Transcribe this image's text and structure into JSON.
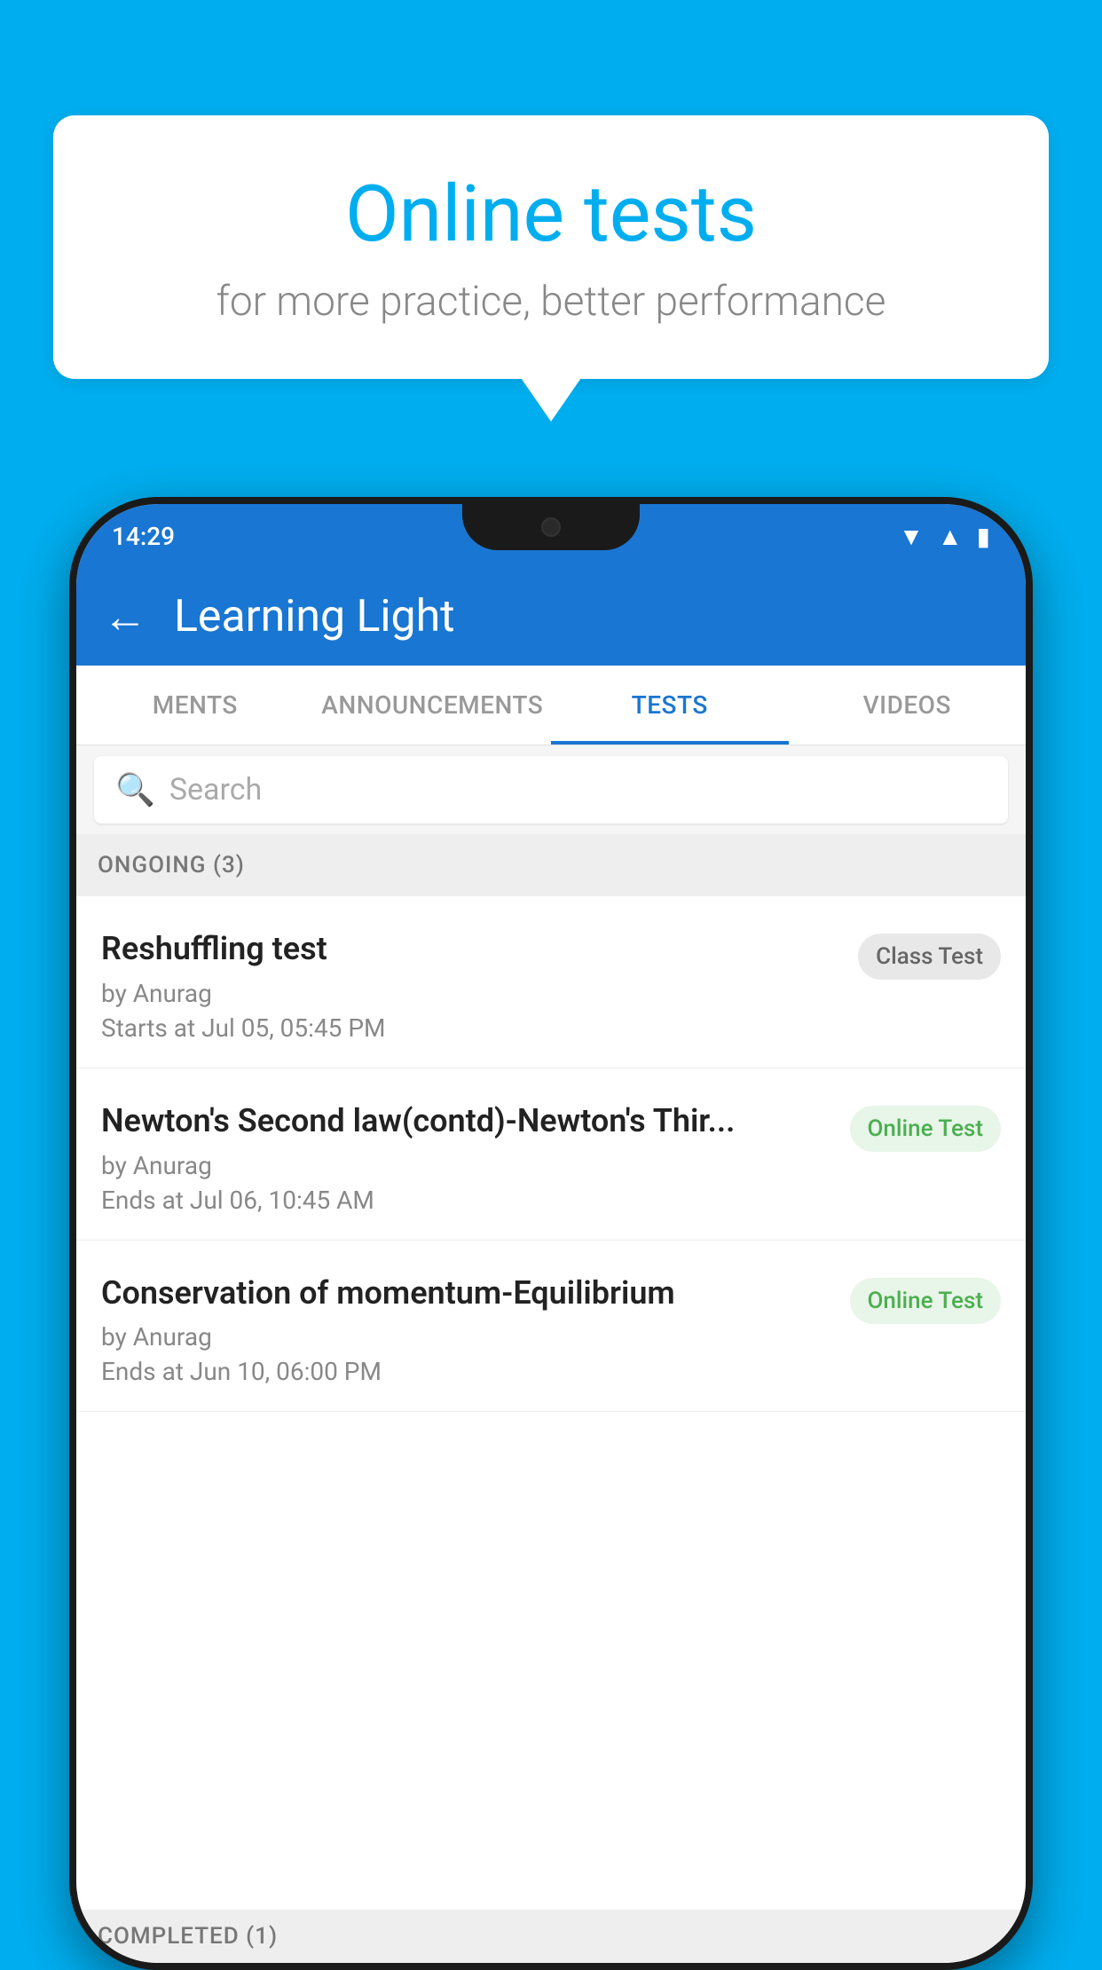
{
  "background_color": "#00AEEF",
  "speech_bubble": {
    "title": "Online tests",
    "subtitle": "for more practice, better performance"
  },
  "phone": {
    "status_bar": {
      "time": "14:29",
      "icons": [
        "wifi",
        "signal",
        "battery"
      ]
    },
    "header": {
      "back_label": "←",
      "title": "Learning Light"
    },
    "tabs": [
      {
        "label": "MENTS",
        "active": false
      },
      {
        "label": "ANNOUNCEMENTS",
        "active": false
      },
      {
        "label": "TESTS",
        "active": true
      },
      {
        "label": "VIDEOS",
        "active": false
      }
    ],
    "search": {
      "placeholder": "Search"
    },
    "ongoing_section": {
      "label": "ONGOING (3)"
    },
    "tests": [
      {
        "name": "Reshuffling test",
        "by": "by Anurag",
        "date": "Starts at  Jul 05, 05:45 PM",
        "badge": "Class Test",
        "badge_type": "class"
      },
      {
        "name": "Newton's Second law(contd)-Newton's Thir...",
        "by": "by Anurag",
        "date": "Ends at  Jul 06, 10:45 AM",
        "badge": "Online Test",
        "badge_type": "online"
      },
      {
        "name": "Conservation of momentum-Equilibrium",
        "by": "by Anurag",
        "date": "Ends at  Jun 10, 06:00 PM",
        "badge": "Online Test",
        "badge_type": "online"
      }
    ],
    "completed_section": {
      "label": "COMPLETED (1)"
    }
  }
}
